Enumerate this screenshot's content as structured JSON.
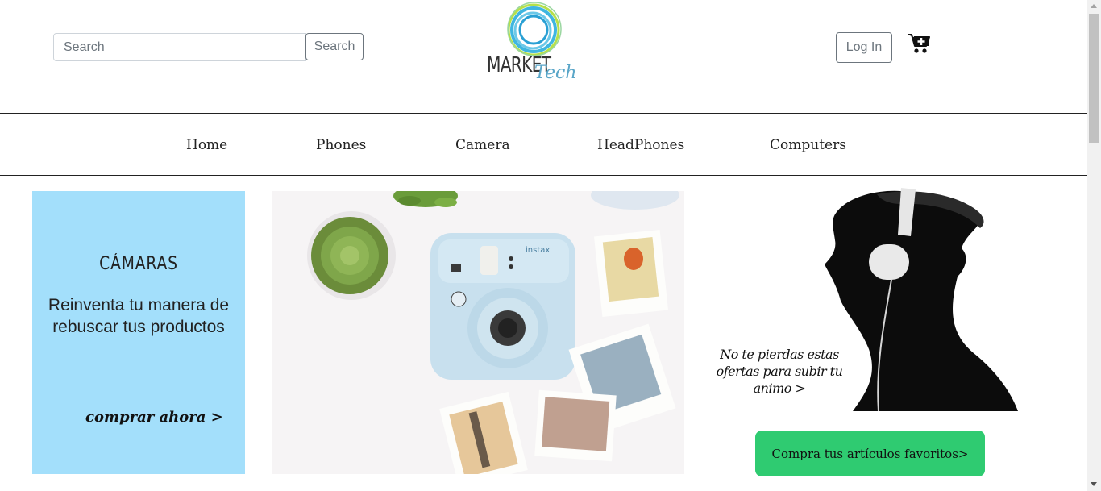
{
  "header": {
    "search_placeholder": "Search",
    "search_button": "Search",
    "logo_primary": "MARKET",
    "logo_secondary": "Tech",
    "login_button": "Log In",
    "cart_icon": "cart-plus-icon"
  },
  "nav": {
    "items": [
      "Home",
      "Phones",
      "Camera",
      "HeadPhones",
      "Computers"
    ]
  },
  "banners": {
    "camera": {
      "title": "CÁMARAS",
      "text": "Reinventa tu manera de rebuscar tus productos",
      "cta": "comprar ahora  >"
    },
    "headphones": {
      "text": "No te pierdas estas ofertas para subir tu animo    >"
    },
    "cta_button": "Compra tus artículos favoritos>"
  },
  "colors": {
    "camera_banner_bg": "#a3dffb",
    "cta_green": "#2fcb71",
    "logo_blue": "#5aa6c8",
    "logo_green": "#b6e04a"
  }
}
